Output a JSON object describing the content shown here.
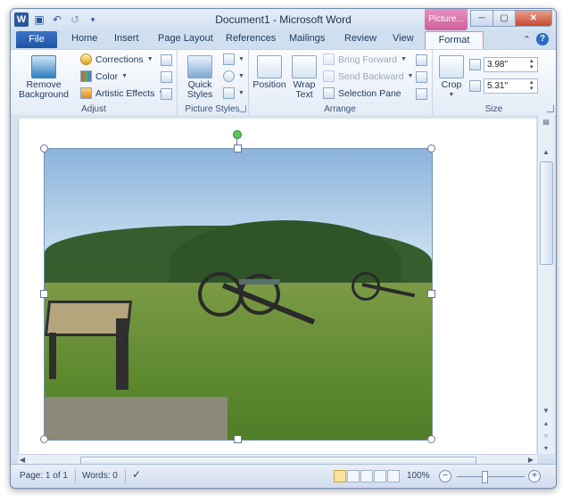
{
  "window": {
    "title": "Document1 - Microsoft Word",
    "context_tab": "Picture...",
    "min_glyph": "─",
    "max_glyph": "▢",
    "close_glyph": "✕"
  },
  "quick_access": {
    "word_glyph": "W",
    "save_glyph": "▣",
    "undo_glyph": "↶",
    "redo_glyph": "↺",
    "customize_glyph": "▾"
  },
  "tabs": [
    "File",
    "Home",
    "Insert",
    "Page Layout",
    "References",
    "Mailings",
    "Review",
    "View",
    "Format"
  ],
  "tab_icons": {
    "collapse_glyph": "⌃",
    "help_glyph": "?"
  },
  "ribbon": {
    "adjust": {
      "label": "Adjust",
      "remove_background": [
        "Remove",
        "Background"
      ],
      "corrections": "Corrections",
      "color": "Color",
      "artistic_effects": "Artistic Effects"
    },
    "picture_styles": {
      "label": "Picture Styles",
      "quick_styles": [
        "Quick",
        "Styles"
      ]
    },
    "arrange": {
      "label": "Arrange",
      "position": "Position",
      "wrap_text": [
        "Wrap",
        "Text"
      ],
      "bring_forward": "Bring Forward",
      "send_backward": "Send Backward",
      "selection_pane": "Selection Pane"
    },
    "size": {
      "label": "Size",
      "crop": "Crop",
      "height": "3.98\"",
      "width": "5.31\""
    }
  },
  "statusbar": {
    "page": "Page: 1 of 1",
    "words": "Words: 0",
    "zoom": "100%",
    "zoom_level_percent": 100,
    "zoom_out_glyph": "−",
    "zoom_in_glyph": "+"
  },
  "icons": {
    "scroll_up": "▲",
    "scroll_down": "▼",
    "prev_page": "▴",
    "browse": "○",
    "next_page": "▾",
    "scroll_left": "◀",
    "scroll_right": "▶"
  },
  "colors": {
    "accent": "#2b579a",
    "context_tab": "#d0609a",
    "rotation_handle": "#5fc25f"
  }
}
